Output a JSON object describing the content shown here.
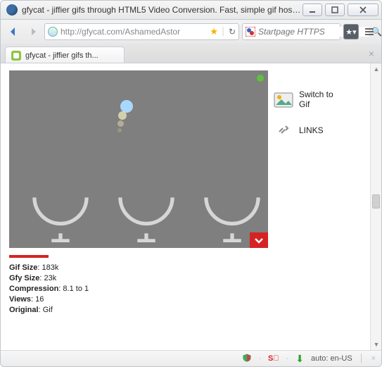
{
  "window": {
    "title": "gfycat - jiffier gifs through HTML5 Video Conversion. Fast, simple gif hosti..."
  },
  "nav": {
    "url": "http://gfycat.com/AshamedAstor",
    "search_placeholder": "Startpage HTTPS"
  },
  "tab": {
    "label": "gfycat - jiffier gifs th..."
  },
  "sidebar": {
    "switch_line1": "Switch to",
    "switch_line2": "Gif",
    "links": "LINKS"
  },
  "stats": {
    "gif_size_label": "Gif Size",
    "gif_size_value": "183k",
    "gfy_size_label": "Gfy Size",
    "gfy_size_value": "23k",
    "compression_label": "Compression",
    "compression_value": "8.1 to 1",
    "views_label": "Views",
    "views_value": "16",
    "original_label": "Original",
    "original_value": "Gif"
  },
  "status": {
    "lang": "auto: en-US"
  }
}
